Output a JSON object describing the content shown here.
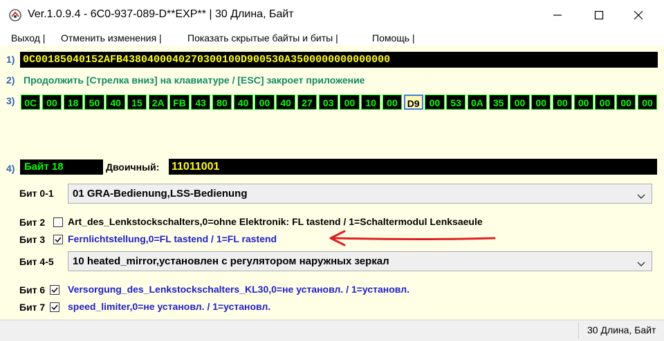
{
  "window": {
    "title": "Ver.1.0.9.4 -    6C0-937-089-D**EXP** | 30 Длина, Байт"
  },
  "menu": [
    {
      "label": "Выход |"
    },
    {
      "label": "Отменить изменения |"
    },
    {
      "label": "Показать скрытые байты и биты |"
    },
    {
      "label": "Помощь |"
    }
  ],
  "row_numbers": {
    "r1": "1)",
    "r2": "2)",
    "r3": "3)",
    "r4": "4)"
  },
  "hex_string": "0C00185040152AFB4380400040270300100D900530A3500000000000000",
  "hint": "Продолжить [Стрелка вниз] на клавиатуре / [ESC] закроет приложение",
  "bytes": [
    "0C",
    "00",
    "18",
    "50",
    "40",
    "15",
    "2A",
    "FB",
    "43",
    "80",
    "40",
    "00",
    "40",
    "27",
    "03",
    "00",
    "10",
    "00",
    "D9",
    "00",
    "53",
    "0A",
    "35",
    "00",
    "00",
    "00",
    "00",
    "00",
    "00",
    "00"
  ],
  "selected_byte_index": 18,
  "byte_info": {
    "label": "Байт 18",
    "binary_label": "Двоичный:",
    "binary_value": "11011001"
  },
  "bits": {
    "bit01": {
      "label": "Бит 0-1",
      "value": "01 GRA-Bedienung,LSS-Bedienung"
    },
    "bit2": {
      "label": "Бит 2",
      "checked": false,
      "text": "Art_des_Lenkstockschalters,0=ohne Elektronik: FL tastend / 1=Schaltermodul Lenksaeule",
      "color": "#000000"
    },
    "bit3": {
      "label": "Бит 3",
      "checked": true,
      "text": "Fernlichtstellung,0=FL tastend / 1=FL rastend",
      "color": "#1e1ecc"
    },
    "bit45": {
      "label": "Бит 4-5",
      "value": "10 heated_mirror,установлен с регулятором наружных зеркал"
    },
    "bit6": {
      "label": "Бит 6",
      "checked": true,
      "text": "Versorgung_des_Lenkstockschalters_KL30,0=не установл. / 1=установл.",
      "color": "#1e1ecc"
    },
    "bit7": {
      "label": "Бит 7",
      "checked": true,
      "text": "speed_limiter,0=не установл. / 1=установл.",
      "color": "#1e1ecc"
    }
  },
  "status": "30 Длина, Байт",
  "colors": {
    "accent_blue": "#1e1ecc",
    "hint_green": "#128a63",
    "byte_green": "#00ff00",
    "hex_yellow": "#ffff00",
    "arrow_red": "#e02020"
  }
}
